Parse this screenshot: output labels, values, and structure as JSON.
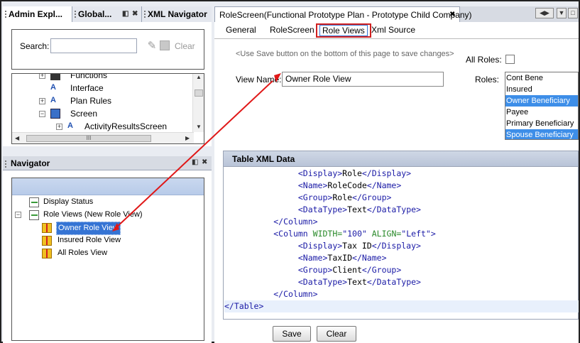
{
  "left_tabs": [
    {
      "label": "Admin Expl..."
    },
    {
      "label": "Global..."
    },
    {
      "label": "XML Navigator"
    }
  ],
  "search": {
    "label": "Search:",
    "value": "",
    "clear_label": "Clear"
  },
  "tree": {
    "items": [
      {
        "label": "Functions"
      },
      {
        "label": "Interface"
      },
      {
        "label": "Plan Rules"
      },
      {
        "label": "Screen"
      },
      {
        "label": "ActivityResultsScreen"
      }
    ],
    "hscroll_grip": "III"
  },
  "navigator": {
    "title": "Navigator",
    "items": [
      {
        "label": "Display Status"
      },
      {
        "label": "Role Views (New Role View)"
      },
      {
        "label": "Owner Role View"
      },
      {
        "label": "Insured Role View"
      },
      {
        "label": "All Roles View"
      }
    ]
  },
  "editor_tab": {
    "title": "RoleScreen(Functional Prototype Plan - Prototype Child Company)"
  },
  "subtabs": [
    {
      "label": "General"
    },
    {
      "label": "RoleScreen"
    },
    {
      "label": "Role Views"
    },
    {
      "label": "Xml Source"
    }
  ],
  "form": {
    "hint": "<Use Save button on the bottom of this page to save changes>",
    "all_roles_label": "All Roles:",
    "all_roles_checked": false,
    "view_name_label": "View Name:",
    "view_name_value": "Owner Role View",
    "roles_label": "Roles:",
    "roles": [
      {
        "label": "Cont Bene",
        "selected": false
      },
      {
        "label": "Insured",
        "selected": false
      },
      {
        "label": "Owner Beneficiary",
        "selected": true
      },
      {
        "label": "Payee",
        "selected": false
      },
      {
        "label": "Primary Beneficiary",
        "selected": false
      },
      {
        "label": "Spouse Beneficiary",
        "selected": true
      }
    ]
  },
  "xml": {
    "title": "Table XML Data",
    "lines": [
      {
        "indent": "          ",
        "parts": [
          [
            "tg",
            "<Display>"
          ],
          [
            "tx",
            "Role"
          ],
          [
            "tg",
            "</Display>"
          ]
        ]
      },
      {
        "indent": "          ",
        "parts": [
          [
            "tg",
            "<Name>"
          ],
          [
            "tx",
            "RoleCode"
          ],
          [
            "tg",
            "</Name>"
          ]
        ]
      },
      {
        "indent": "          ",
        "parts": [
          [
            "tg",
            "<Group>"
          ],
          [
            "tx",
            "Role"
          ],
          [
            "tg",
            "</Group>"
          ]
        ]
      },
      {
        "indent": "          ",
        "parts": [
          [
            "tg",
            "<DataType>"
          ],
          [
            "tx",
            "Text"
          ],
          [
            "tg",
            "</DataType>"
          ]
        ]
      },
      {
        "indent": "     ",
        "parts": [
          [
            "tg",
            "</Column>"
          ]
        ]
      },
      {
        "indent": "     ",
        "parts": [
          [
            "tg",
            "<Column "
          ],
          [
            "at",
            "WIDTH="
          ],
          [
            "av",
            "\"100\""
          ],
          [
            "tx",
            " "
          ],
          [
            "at",
            "ALIGN="
          ],
          [
            "av",
            "\"Left\""
          ],
          [
            "tg",
            ">"
          ]
        ]
      },
      {
        "indent": "          ",
        "parts": [
          [
            "tg",
            "<Display>"
          ],
          [
            "tx",
            "Tax ID"
          ],
          [
            "tg",
            "</Display>"
          ]
        ]
      },
      {
        "indent": "          ",
        "parts": [
          [
            "tg",
            "<Name>"
          ],
          [
            "tx",
            "TaxID"
          ],
          [
            "tg",
            "</Name>"
          ]
        ]
      },
      {
        "indent": "          ",
        "parts": [
          [
            "tg",
            "<Group>"
          ],
          [
            "tx",
            "Client"
          ],
          [
            "tg",
            "</Group>"
          ]
        ]
      },
      {
        "indent": "          ",
        "parts": [
          [
            "tg",
            "<DataType>"
          ],
          [
            "tx",
            "Text"
          ],
          [
            "tg",
            "</DataType>"
          ]
        ]
      },
      {
        "indent": "     ",
        "parts": [
          [
            "tg",
            "</Column>"
          ]
        ]
      },
      {
        "indent": "",
        "parts": [
          [
            "tg",
            "</Table>"
          ]
        ]
      }
    ]
  },
  "buttons": {
    "save": "Save",
    "clear": "Clear"
  },
  "colors": {
    "selection": "#3574d4",
    "highlight_border": "#d02020",
    "arrow": "#e01818"
  }
}
